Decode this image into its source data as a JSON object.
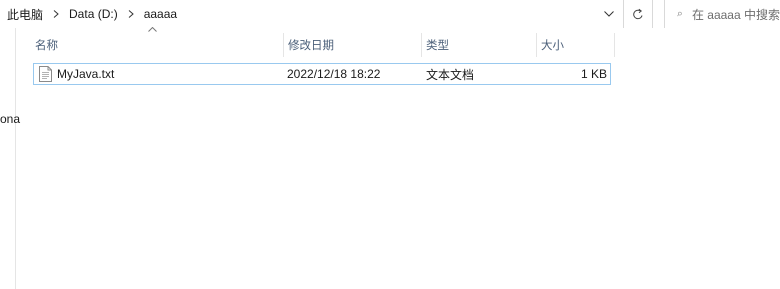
{
  "address": {
    "crumbs": [
      "此电脑",
      "Data (D:)",
      "aaaaa"
    ]
  },
  "search": {
    "placeholder": "在 aaaaa 中搜索"
  },
  "nav": {
    "partial_label": "ona"
  },
  "columns": {
    "name": "名称",
    "modified": "修改日期",
    "type": "类型",
    "size": "大小"
  },
  "files": [
    {
      "name": "MyJava.txt",
      "modified": "2022/12/18 18:22",
      "type": "文本文档",
      "size": "1 KB"
    }
  ],
  "colors": {
    "header_text": "#4c607a",
    "row_border": "#99c9ef",
    "separator": "#e5e5e5"
  }
}
